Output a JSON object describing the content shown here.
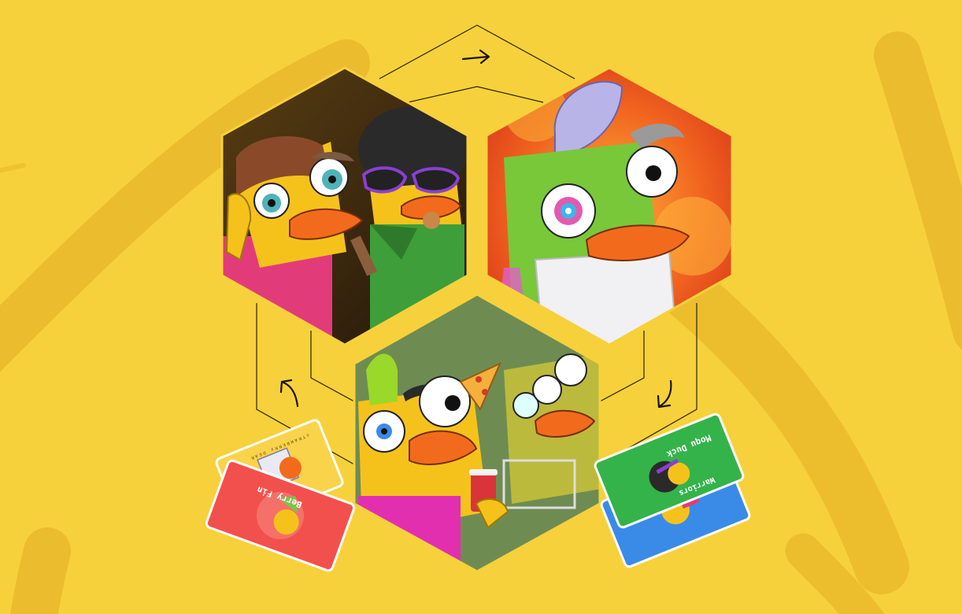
{
  "colors": {
    "background": "#F7D13B",
    "swoosh": "#E8B92C",
    "hex_top_left_bg": "#3A2C0E",
    "hex_top_right_bg": "#E85A1E",
    "hex_bottom_bg": "#6E8C52",
    "duck_yellow": "#F5C21B",
    "beak_orange": "#F26B1D",
    "connector_line": "#2b2300"
  },
  "cards": {
    "left_back": {
      "text": "ˢᵀᴿᴬᵂᴮᴱᴿᴿʸ ᴰᴱᴬᴿ",
      "color": "#F9D34A"
    },
    "left_front": {
      "text": "Berry Fin",
      "color": "#F2504D"
    },
    "right_back": {
      "text": "Moqu Duck",
      "color": "#34B34A"
    },
    "right_front": {
      "text": "Warriors",
      "color": "#3A8BE8"
    }
  },
  "icons": [
    "arrow-right-icon",
    "arrow-down-icon",
    "arrow-up-icon"
  ]
}
